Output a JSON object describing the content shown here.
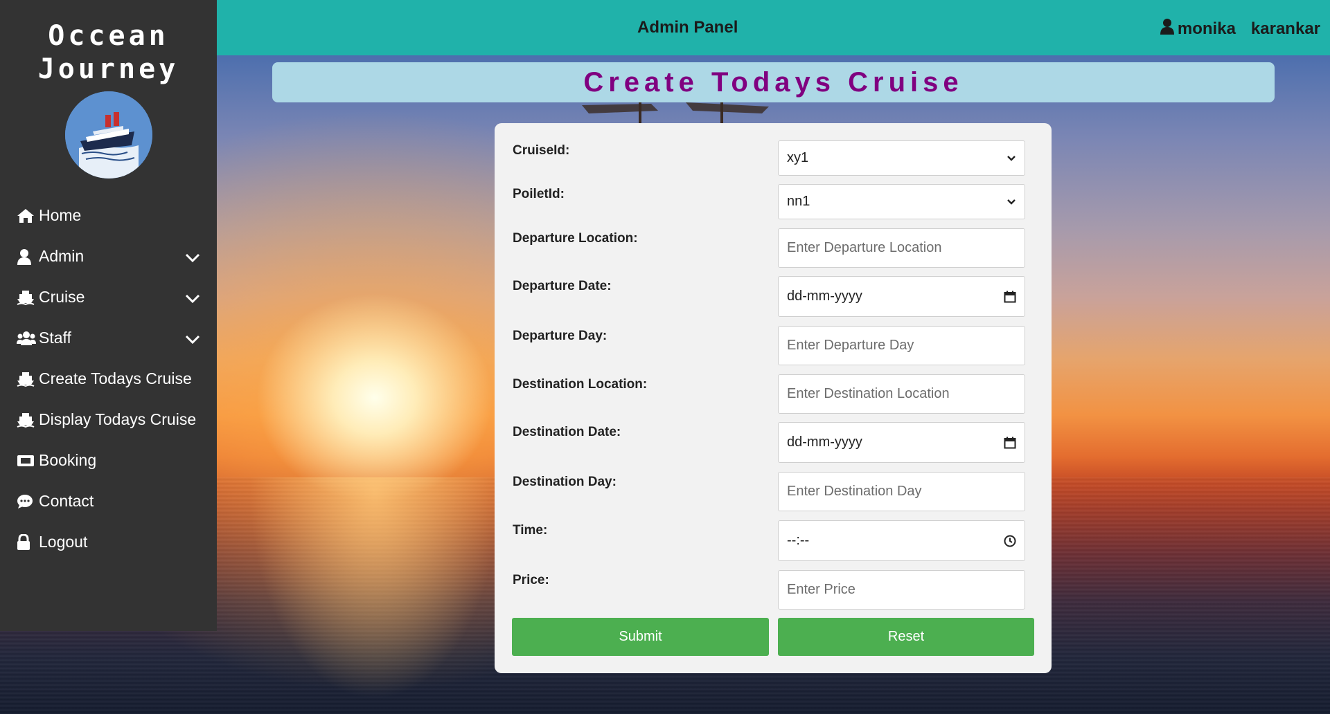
{
  "sidebar": {
    "brand_line1": "Occean",
    "brand_line2": "Journey",
    "items": [
      {
        "label": "Home",
        "icon": "home-icon"
      },
      {
        "label": "Admin",
        "icon": "user-icon",
        "has_dropdown": true
      },
      {
        "label": "Cruise",
        "icon": "ship-icon",
        "has_dropdown": true
      },
      {
        "label": "Staff",
        "icon": "users-icon",
        "has_dropdown": true
      },
      {
        "label": "Create Todays Cruise",
        "icon": "ship-icon"
      },
      {
        "label": "Display Todays Cruise",
        "icon": "ship-icon"
      },
      {
        "label": "Booking",
        "icon": "ticket-icon"
      },
      {
        "label": "Contact",
        "icon": "chat-icon"
      },
      {
        "label": "Logout",
        "icon": "lock-icon"
      }
    ]
  },
  "header": {
    "title": "Admin Panel",
    "user_first": "monika",
    "user_last": "karankar"
  },
  "page": {
    "heading": "Create Todays Cruise"
  },
  "form": {
    "cruise_id": {
      "label": "CruiseId:",
      "value": "xy1"
    },
    "poilet_id": {
      "label": "PoiletId:",
      "value": "nn1"
    },
    "departure_location": {
      "label": "Departure Location:",
      "placeholder": "Enter Departure Location"
    },
    "departure_date": {
      "label": "Departure Date:",
      "placeholder": "dd-mm-yyyy"
    },
    "departure_day": {
      "label": "Departure Day:",
      "placeholder": "Enter Departure Day"
    },
    "destination_location": {
      "label": "Destination Location:",
      "placeholder": "Enter Destination Location"
    },
    "destination_date": {
      "label": "Destination Date:",
      "placeholder": "dd-mm-yyyy"
    },
    "destination_day": {
      "label": "Destination Day:",
      "placeholder": "Enter Destination Day"
    },
    "time": {
      "label": "Time:",
      "placeholder": "--:--"
    },
    "price": {
      "label": "Price:",
      "placeholder": "Enter Price"
    },
    "submit_label": "Submit",
    "reset_label": "Reset"
  },
  "colors": {
    "sidebar_bg": "#333333",
    "topbar_bg": "#20b2aa",
    "heading_bg": "#add8e6",
    "heading_text": "#800080",
    "button_bg": "#4caf50"
  }
}
